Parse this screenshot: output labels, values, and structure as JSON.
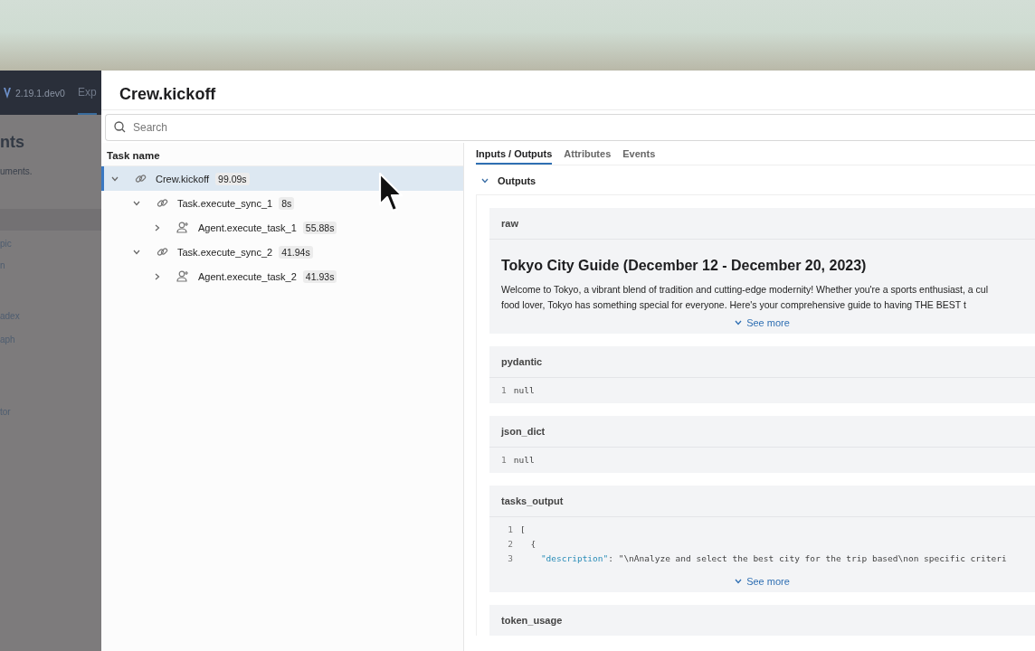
{
  "background_app": {
    "version": "2.19.1.dev0",
    "nav_tab": "Exp",
    "heading": "nts",
    "subtitle": "uments.",
    "menu_items": [
      "pic",
      "n",
      "adex",
      "aph",
      "tor"
    ]
  },
  "panel": {
    "title": "Crew.kickoff",
    "search": {
      "placeholder": "Search"
    },
    "tree": {
      "column": "Task name",
      "rows": [
        {
          "kind": "link",
          "name": "Crew.kickoff",
          "duration": "99.09s",
          "expanded": true,
          "selected": true,
          "children": [
            {
              "kind": "link",
              "name": "Task.execute_sync_1",
              "duration": "8s",
              "expanded": true,
              "selected": false,
              "children": [
                {
                  "kind": "agent",
                  "name": "Agent.execute_task_1",
                  "duration": "55.88s",
                  "expanded": false,
                  "selected": false
                }
              ]
            },
            {
              "kind": "link",
              "name": "Task.execute_sync_2",
              "duration": "41.94s",
              "expanded": true,
              "selected": false,
              "children": [
                {
                  "kind": "agent",
                  "name": "Agent.execute_task_2",
                  "duration": "41.93s",
                  "expanded": false,
                  "selected": false
                }
              ]
            }
          ]
        }
      ]
    },
    "tabs": [
      {
        "label": "Inputs / Outputs",
        "selected": true
      },
      {
        "label": "Attributes",
        "selected": false
      },
      {
        "label": "Events",
        "selected": false
      }
    ],
    "section": {
      "title": "Outputs",
      "expanded": true
    },
    "fields": [
      {
        "kind": "markdown",
        "name": "raw",
        "heading": "Tokyo City Guide (December 12 - December 20, 2023)",
        "lines": [
          "Welcome to Tokyo, a vibrant blend of tradition and cutting-edge modernity! Whether you're a sports enthusiast, a cul",
          "food lover, Tokyo has something special for everyone. Here's your comprehensive guide to having THE BEST t"
        ],
        "more": "See more"
      },
      {
        "kind": "code",
        "name": "pydantic",
        "lines": [
          {
            "no": "1",
            "text": "null"
          }
        ]
      },
      {
        "kind": "code",
        "name": "json_dict",
        "lines": [
          {
            "no": "1",
            "text": "null"
          }
        ]
      },
      {
        "kind": "code",
        "name": "tasks_output",
        "lines": [
          {
            "no": "1",
            "text": "["
          },
          {
            "no": "2",
            "text": "  {"
          },
          {
            "no": "3",
            "key": "    \"description\"",
            "text": ": \"\\nAnalyze and select the best city for the trip based\\non specific criteri"
          }
        ],
        "more": "See more"
      },
      {
        "kind": "header",
        "name": "token_usage"
      }
    ]
  }
}
